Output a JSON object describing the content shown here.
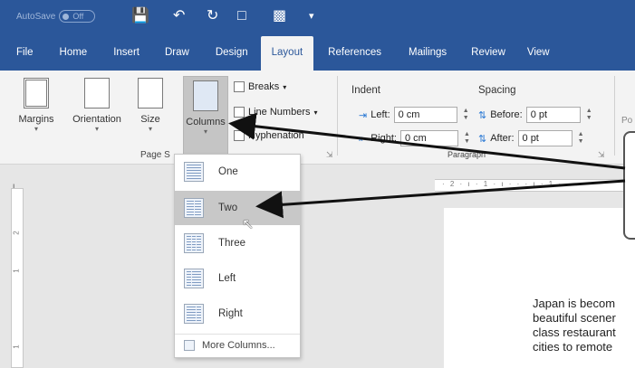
{
  "titlebar": {
    "autosave_label": "AutoSave",
    "autosave_state": "Off",
    "icons": [
      "save-icon",
      "undo-icon",
      "redo-icon",
      "new-doc-icon",
      "open-folder-icon",
      "customize-icon"
    ]
  },
  "tabs": [
    {
      "label": "File"
    },
    {
      "label": "Home"
    },
    {
      "label": "Insert"
    },
    {
      "label": "Draw"
    },
    {
      "label": "Design"
    },
    {
      "label": "Layout"
    },
    {
      "label": "References"
    },
    {
      "label": "Mailings"
    },
    {
      "label": "Review"
    },
    {
      "label": "View"
    }
  ],
  "ribbon": {
    "margins": "Margins",
    "orientation": "Orientation",
    "size": "Size",
    "columns": "Columns",
    "breaks": "Breaks",
    "line_numbers": "Line Numbers",
    "hyphenation": "Hyphenation",
    "page_setup_label": "Page S",
    "indent_head": "Indent",
    "spacing_head": "Spacing",
    "left_label": "Left:",
    "left_value": "0 cm",
    "right_label": "Right:",
    "right_value": "0 cm",
    "before_label": "Before:",
    "before_value": "0 pt",
    "after_label": "After:",
    "after_value": "0 pt",
    "paragraph_label": "Paragraph",
    "cut_label": "Po"
  },
  "dropdown": {
    "options": [
      {
        "label": "One"
      },
      {
        "label": "Two"
      },
      {
        "label": "Three"
      },
      {
        "label": "Left"
      },
      {
        "label": "Right"
      }
    ],
    "more": "More Columns..."
  },
  "ruler": {
    "corner": "L",
    "h_marks": "· 2 · ı · 1 · ı · · · ı · 1 ·",
    "v_marks": [
      "2",
      "1",
      "1"
    ]
  },
  "document": {
    "lines": [
      "Japan is becom",
      "beautiful scener",
      "class restaurant",
      "cities to remote"
    ]
  },
  "colors": {
    "word_blue": "#2b579a",
    "ribbon_bg": "#f3f3f3",
    "hover_gray": "#c8c8c8"
  }
}
